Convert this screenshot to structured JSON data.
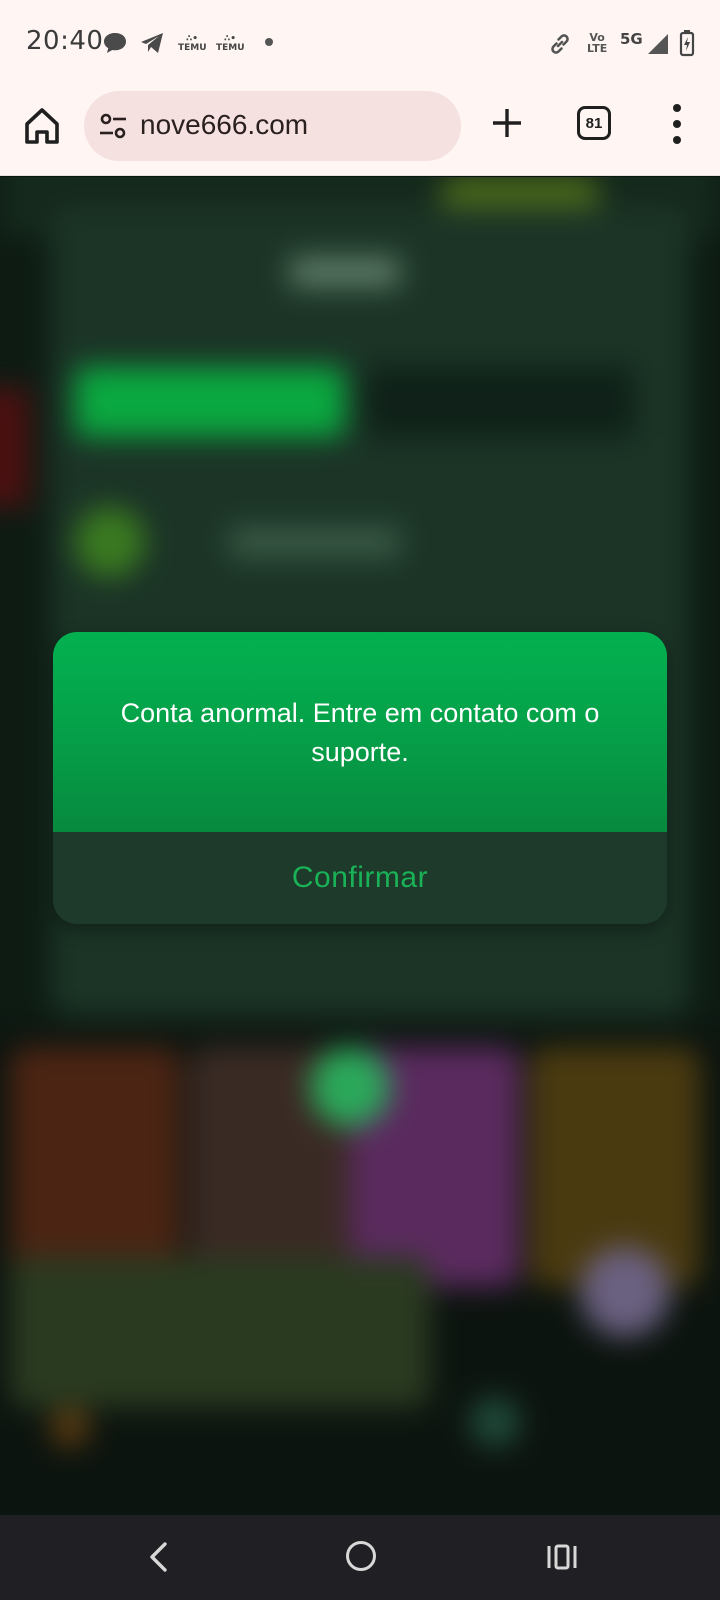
{
  "status_bar": {
    "time": "20:40",
    "notification_icons": [
      "chat-bubble-icon",
      "telegram-icon",
      "temu-icon",
      "temu-icon",
      "more-dot-icon"
    ],
    "temu_label": "TEMU",
    "volte_label_top": "Vo",
    "volte_label_bottom": "LTE",
    "network_label": "5G",
    "right_icons": [
      "link-icon",
      "volte-icon",
      "signal-icon",
      "battery-charging-icon"
    ]
  },
  "browser": {
    "url": "nove666.com",
    "tab_count": "81",
    "icons": [
      "home-icon",
      "site-settings-icon",
      "new-tab-plus-icon",
      "tabs-icon",
      "overflow-menu-icon"
    ]
  },
  "dialog": {
    "message": "Conta anormal. Entre em contato com o suporte.",
    "confirm_label": "Confirmar",
    "colors": {
      "header": "#03b150",
      "button_bg": "#1d3a2b",
      "button_text": "#1ab257"
    }
  },
  "nav_bar": {
    "icons": [
      "back-icon",
      "home-circle-icon",
      "recents-icon"
    ]
  }
}
